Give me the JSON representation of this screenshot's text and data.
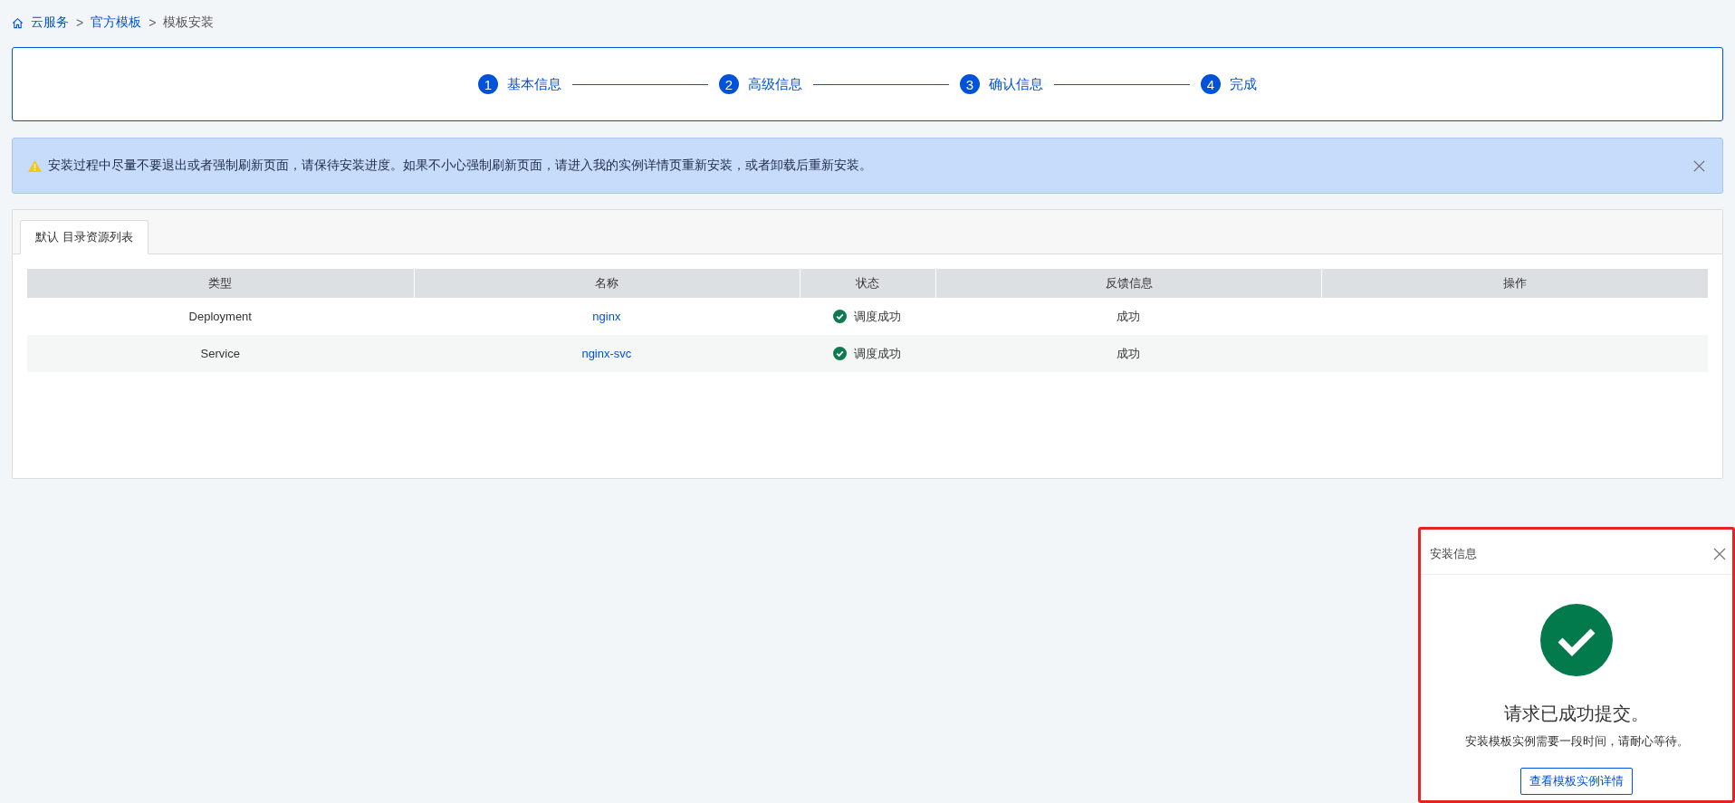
{
  "breadcrumb": [
    {
      "label": "云服务",
      "link": true
    },
    {
      "label": "官方模板",
      "link": true
    },
    {
      "label": "模板安装",
      "link": false
    }
  ],
  "breadcrumb_separator": ">",
  "steps": [
    {
      "number": "1",
      "label": "基本信息",
      "active": true
    },
    {
      "number": "2",
      "label": "高级信息",
      "active": true
    },
    {
      "number": "3",
      "label": "确认信息",
      "active": true
    },
    {
      "number": "4",
      "label": "完成",
      "active": true
    }
  ],
  "alert": {
    "text": "安装过程中尽量不要退出或者强制刷新页面，请保待安装进度。如果不小心强制刷新页面，请进入我的实例详情页重新安装，或者卸载后重新安装。"
  },
  "tabs": [
    {
      "label": "默认 目录资源列表",
      "selected": true
    }
  ],
  "table": {
    "columns": [
      "类型",
      "名称",
      "状态",
      "反馈信息",
      "操作"
    ],
    "rows": [
      {
        "type": "Deployment",
        "name": "nginx",
        "status": "调度成功",
        "status_ok": true,
        "feedback": "成功"
      },
      {
        "type": "Service",
        "name": "nginx-svc",
        "status": "调度成功",
        "status_ok": true,
        "feedback": "成功"
      }
    ]
  },
  "popup": {
    "title": "安装信息",
    "highlighted": true,
    "heading": "请求已成功提交。",
    "message": "安装模板实例需要一段时间，请耐心等待。",
    "button": "查看模板实例详情"
  }
}
